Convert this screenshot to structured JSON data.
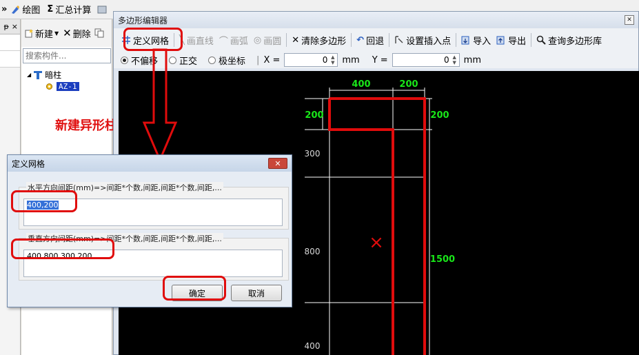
{
  "app_toolbar": {
    "chevron": "»",
    "draw_label": "绘图",
    "sum_label": "汇总计算",
    "sum_symbol": "Σ"
  },
  "left_strip": {
    "pin": "ᵽ",
    "close": "×"
  },
  "component_panel": {
    "new_label": "新建",
    "delete_label": "删除",
    "search_placeholder": "搜索构件...",
    "tree_root": "暗柱",
    "tree_child": "AZ-1",
    "annotation": "新建异形柱"
  },
  "editor": {
    "title": "多边形编辑器",
    "toolbar": [
      {
        "label": "定义网格",
        "icon": "grid-icon",
        "enabled": true
      },
      {
        "label": "画直线",
        "icon": "line-icon",
        "enabled": false
      },
      {
        "label": "画弧",
        "icon": "arc-icon",
        "enabled": false
      },
      {
        "label": "画圆",
        "icon": "circle-icon",
        "enabled": false
      },
      {
        "label": "清除多边形",
        "icon": "clear-icon",
        "enabled": true
      },
      {
        "label": "回退",
        "icon": "undo-icon",
        "enabled": true
      },
      {
        "label": "设置插入点",
        "icon": "insert-point-icon",
        "enabled": true
      },
      {
        "label": "导入",
        "icon": "import-icon",
        "enabled": true
      },
      {
        "label": "导出",
        "icon": "export-icon",
        "enabled": true
      },
      {
        "label": "查询多边形库",
        "icon": "search-icon",
        "enabled": true
      }
    ],
    "coord": {
      "modes": [
        "不偏移",
        "正交",
        "极坐标"
      ],
      "selected": 0,
      "x_label": "X =",
      "x_value": "0",
      "y_label": "Y =",
      "y_value": "0",
      "unit": "mm"
    }
  },
  "canvas_labels": {
    "top_400": "400",
    "top_200": "200",
    "left_200": "200",
    "left_300": "300",
    "left_800": "800",
    "left_400": "400",
    "right_200": "200",
    "right_1500": "1500",
    "marker": "×"
  },
  "dialog": {
    "title": "定义网格",
    "horizontal_label": "水平方向间距(mm)=>间距*个数,间距,间距*个数,间距,...",
    "horizontal_value": "400,200",
    "vertical_label": "垂直方向间距(mm)=>间距*个数,间距,间距*个数,间距,...",
    "vertical_value": "400,800,300,200",
    "ok_label": "确定",
    "cancel_label": "取消"
  },
  "colors": {
    "highlight_red": "#e00c0c",
    "dim_green": "#19e619",
    "canvas_bg": "#000000",
    "selection_blue": "#1c3fbf"
  }
}
